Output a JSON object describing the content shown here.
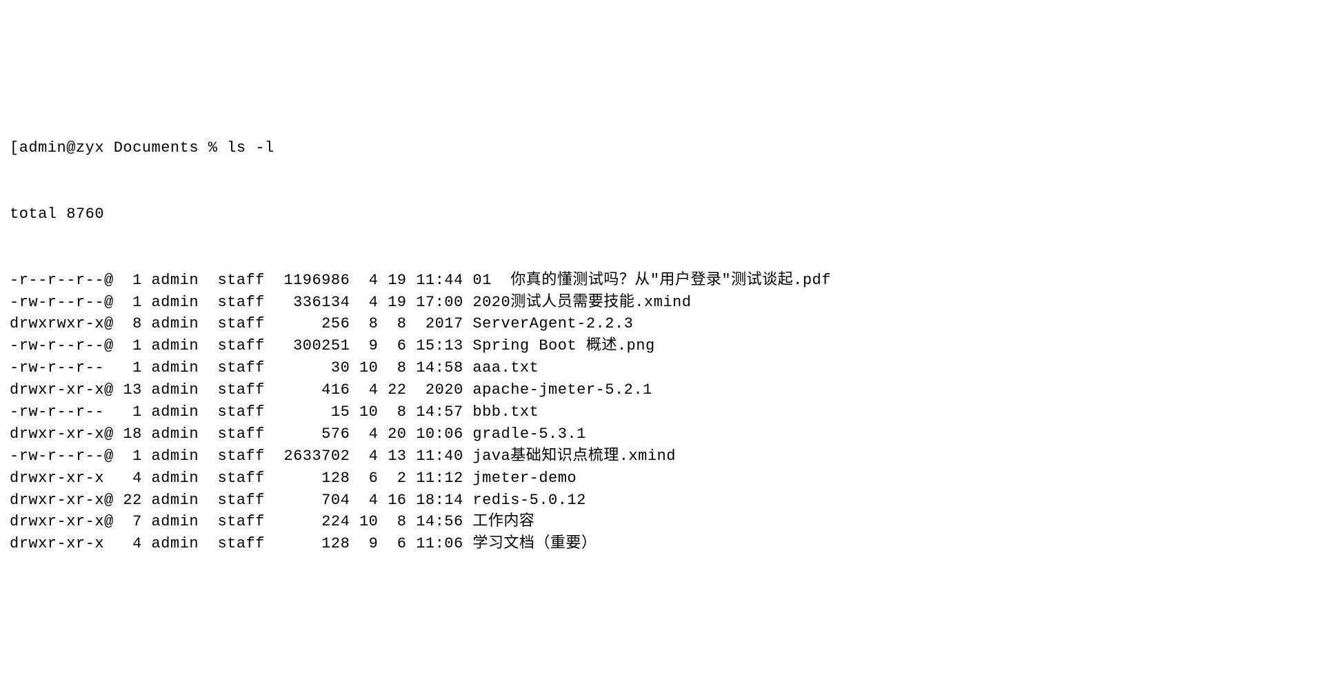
{
  "prompt_line": "[admin@zyx Documents % ls -l",
  "total_line": "total 8760",
  "entries": [
    {
      "perms": "-r--r--r--@",
      "links": "1",
      "owner": "admin",
      "group": "staff",
      "size": "1196986",
      "month": "4",
      "day": "19",
      "time": "11:44",
      "name": "01  你真的懂测试吗？从\"用户登录\"测试谈起.pdf"
    },
    {
      "perms": "-rw-r--r--@",
      "links": "1",
      "owner": "admin",
      "group": "staff",
      "size": "336134",
      "month": "4",
      "day": "19",
      "time": "17:00",
      "name": "2020测试人员需要技能.xmind"
    },
    {
      "perms": "drwxrwxr-x@",
      "links": "8",
      "owner": "admin",
      "group": "staff",
      "size": "256",
      "month": "8",
      "day": "8",
      "time": "2017",
      "name": "ServerAgent-2.2.3"
    },
    {
      "perms": "-rw-r--r--@",
      "links": "1",
      "owner": "admin",
      "group": "staff",
      "size": "300251",
      "month": "9",
      "day": "6",
      "time": "15:13",
      "name": "Spring Boot 概述.png"
    },
    {
      "perms": "-rw-r--r--",
      "links": "1",
      "owner": "admin",
      "group": "staff",
      "size": "30",
      "month": "10",
      "day": "8",
      "time": "14:58",
      "name": "aaa.txt"
    },
    {
      "perms": "drwxr-xr-x@",
      "links": "13",
      "owner": "admin",
      "group": "staff",
      "size": "416",
      "month": "4",
      "day": "22",
      "time": "2020",
      "name": "apache-jmeter-5.2.1"
    },
    {
      "perms": "-rw-r--r--",
      "links": "1",
      "owner": "admin",
      "group": "staff",
      "size": "15",
      "month": "10",
      "day": "8",
      "time": "14:57",
      "name": "bbb.txt"
    },
    {
      "perms": "drwxr-xr-x@",
      "links": "18",
      "owner": "admin",
      "group": "staff",
      "size": "576",
      "month": "4",
      "day": "20",
      "time": "10:06",
      "name": "gradle-5.3.1"
    },
    {
      "perms": "-rw-r--r--@",
      "links": "1",
      "owner": "admin",
      "group": "staff",
      "size": "2633702",
      "month": "4",
      "day": "13",
      "time": "11:40",
      "name": "java基础知识点梳理.xmind"
    },
    {
      "perms": "drwxr-xr-x",
      "links": "4",
      "owner": "admin",
      "group": "staff",
      "size": "128",
      "month": "6",
      "day": "2",
      "time": "11:12",
      "name": "jmeter-demo"
    },
    {
      "perms": "drwxr-xr-x@",
      "links": "22",
      "owner": "admin",
      "group": "staff",
      "size": "704",
      "month": "4",
      "day": "16",
      "time": "18:14",
      "name": "redis-5.0.12"
    },
    {
      "perms": "drwxr-xr-x@",
      "links": "7",
      "owner": "admin",
      "group": "staff",
      "size": "224",
      "month": "10",
      "day": "8",
      "time": "14:56",
      "name": "工作内容"
    },
    {
      "perms": "drwxr-xr-x",
      "links": "4",
      "owner": "admin",
      "group": "staff",
      "size": "128",
      "month": "9",
      "day": "6",
      "time": "11:06",
      "name": "学习文档（重要）"
    }
  ]
}
